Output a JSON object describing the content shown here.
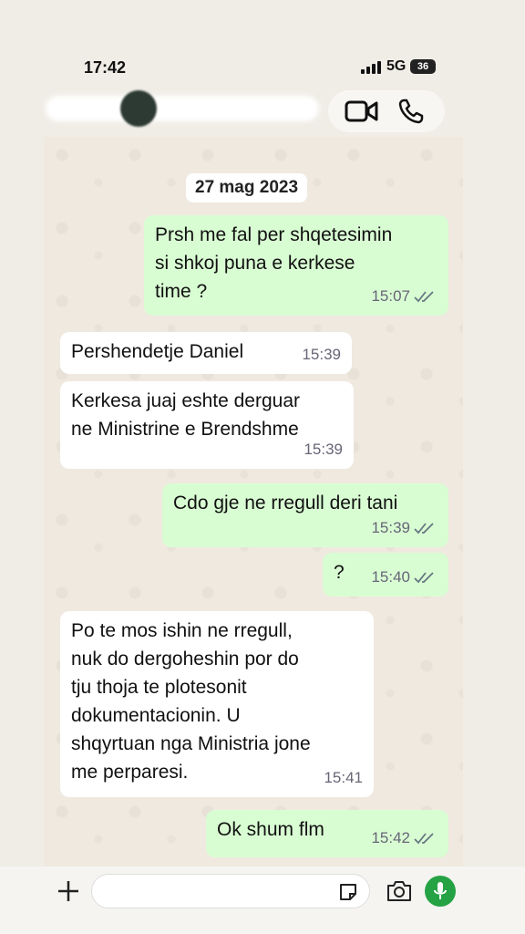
{
  "status_bar": {
    "time": "17:42",
    "network": "5G",
    "battery": "36"
  },
  "chat": {
    "date_chip": "27 mag 2023",
    "messages": [
      {
        "direction": "out",
        "lines": [
          "Prsh me fal per shqetesimin",
          "si shkoj puna e kerkese",
          "time ?"
        ],
        "time": "15:07",
        "read": true
      },
      {
        "direction": "in",
        "lines": [
          "Pershendetje Daniel"
        ],
        "time": "15:39"
      },
      {
        "direction": "in",
        "lines": [
          "Kerkesa juaj eshte derguar",
          "ne Ministrine e Brendshme"
        ],
        "time": "15:39"
      },
      {
        "direction": "out",
        "lines": [
          "Cdo gje ne rregull deri tani"
        ],
        "time": "15:39",
        "read": true
      },
      {
        "direction": "out",
        "lines": [
          "?"
        ],
        "time": "15:40",
        "read": true
      },
      {
        "direction": "in",
        "lines": [
          "Po te mos ishin ne rregull,",
          "nuk do dergoheshin por do",
          "tju thoja te plotesonit",
          "dokumentacionin. U",
          "shqyrtuan nga Ministria jone",
          "me perparesi."
        ],
        "time": "15:41"
      },
      {
        "direction": "out",
        "lines": [
          "Ok shum flm"
        ],
        "time": "15:42",
        "read": true
      }
    ]
  },
  "icons": {
    "video_call": "video-camera-icon",
    "voice_call": "phone-icon",
    "attach": "plus-icon",
    "sticker": "sticker-icon",
    "camera": "camera-icon",
    "mic": "microphone-icon"
  },
  "colors": {
    "outgoing_bubble": "#d9fdd3",
    "incoming_bubble": "#ffffff",
    "read_ticks": "#667781",
    "mic_button": "#25a244"
  }
}
